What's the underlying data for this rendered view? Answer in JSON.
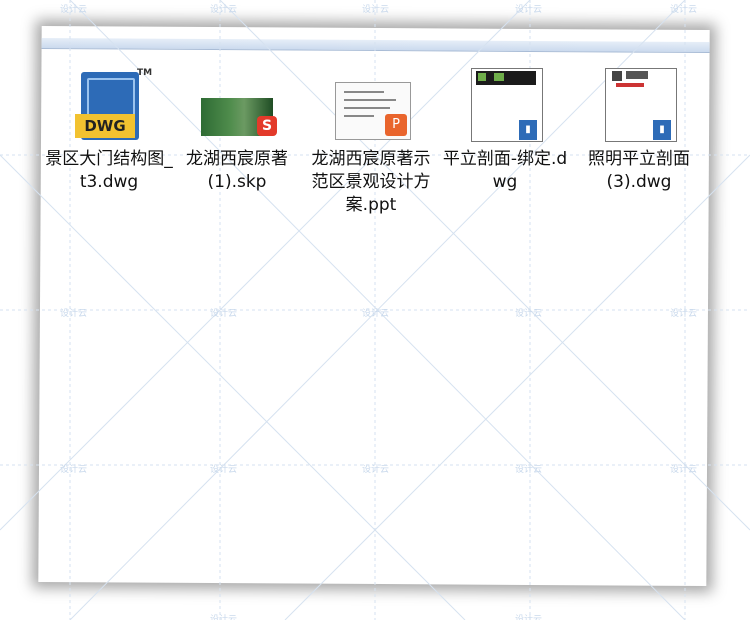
{
  "files": [
    {
      "name": "景区大门结构图_t3.dwg",
      "icon": "dwg-icon",
      "tag": "DWG",
      "tm": "TM"
    },
    {
      "name": "龙湖西宸原著 (1).skp",
      "icon": "sketchup-icon"
    },
    {
      "name": "龙湖西宸原著示范区景观设计方案.ppt",
      "icon": "powerpoint-icon"
    },
    {
      "name": "平立剖面-绑定.dwg",
      "icon": "drawing-thumbnail-icon"
    },
    {
      "name": "照明平立剖面(3).dwg",
      "icon": "drawing-thumbnail-icon"
    }
  ],
  "watermark": "设计云",
  "colors": {
    "topbar": "#cbdaee",
    "dwg_blue": "#2d6bb7",
    "dwg_yellow": "#f2c230",
    "skp_red": "#e33a2a",
    "ppt_orange": "#e9652d"
  }
}
